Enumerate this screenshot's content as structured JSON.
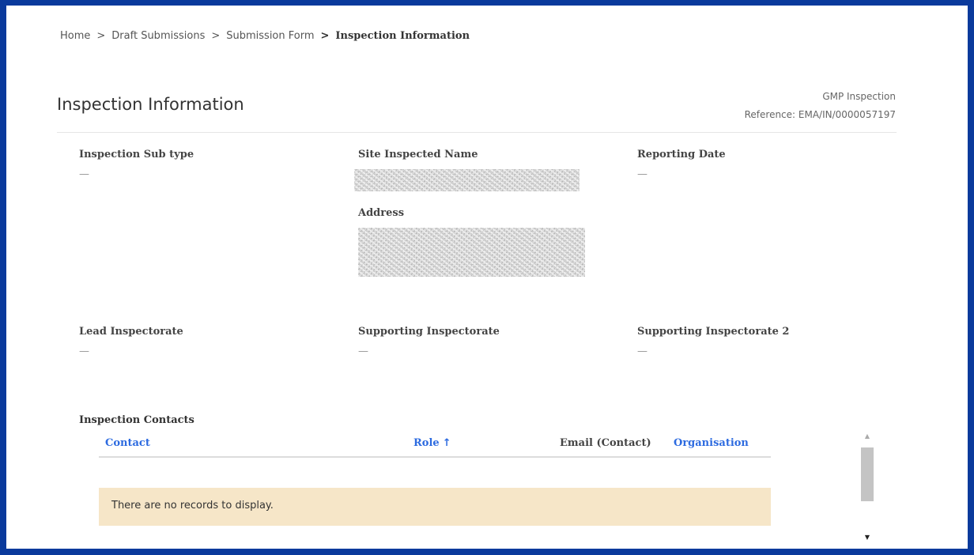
{
  "breadcrumb": {
    "items": [
      "Home",
      "Draft Submissions",
      "Submission Form"
    ],
    "current": "Inspection Information",
    "separator": ">"
  },
  "page": {
    "title": "Inspection Information",
    "type": "GMP Inspection",
    "reference": "Reference: EMA/IN/0000057197"
  },
  "fields": {
    "inspection_sub_type": {
      "label": "Inspection Sub type",
      "value": "—"
    },
    "site_inspected_name": {
      "label": "Site Inspected Name"
    },
    "reporting_date": {
      "label": "Reporting Date",
      "value": "—"
    },
    "address": {
      "label": "Address"
    },
    "lead_inspectorate": {
      "label": "Lead Inspectorate",
      "value": "—"
    },
    "supporting_inspectorate": {
      "label": "Supporting Inspectorate",
      "value": "—"
    },
    "supporting_inspectorate_2": {
      "label": "Supporting Inspectorate 2",
      "value": "—"
    }
  },
  "contacts": {
    "title": "Inspection Contacts",
    "columns": {
      "contact": "Contact",
      "role": "Role",
      "email": "Email (Contact)",
      "organisation": "Organisation"
    },
    "sort_arrow": "🡑",
    "empty_message": "There are no records to display."
  },
  "scrollbar": {
    "up": "▲",
    "down": "▼"
  },
  "colors": {
    "frame_border": "#0a3a9c",
    "link": "#2d6be0",
    "empty_row_bg": "#f6e6c8"
  }
}
